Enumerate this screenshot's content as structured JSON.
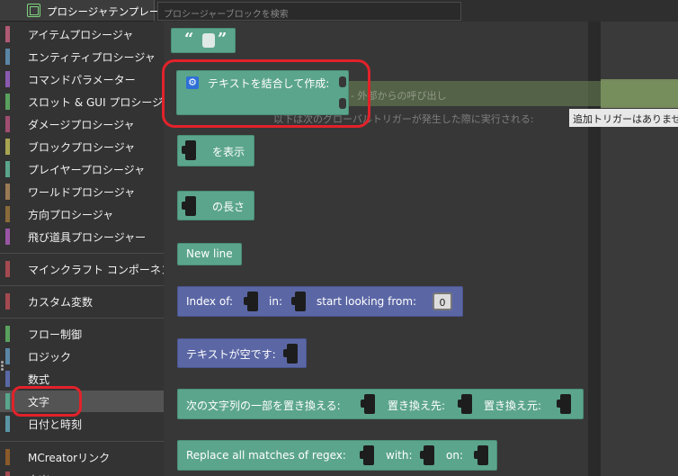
{
  "tab": {
    "label": "プロシージャテンプレート"
  },
  "search": {
    "placeholder": "プロシージャーブロックを検索"
  },
  "sidebar": {
    "group1": [
      {
        "label": "アイテムプロシージャ",
        "color": "#b05a73"
      },
      {
        "label": "エンティティプロシージャ",
        "color": "#5a86a5"
      },
      {
        "label": "コマンドパラメーター",
        "color": "#8a5ab0"
      },
      {
        "label": "スロット & GUI プロシージャ",
        "color": "#5aa05e"
      },
      {
        "label": "ダメージプロシージャ",
        "color": "#a14e70"
      },
      {
        "label": "ブロックプロシージャ",
        "color": "#a8a552"
      },
      {
        "label": "プレイヤープロシージャ",
        "color": "#5aa58c"
      },
      {
        "label": "ワールドプロシージャ",
        "color": "#9a7a55"
      },
      {
        "label": "方向プロシージャ",
        "color": "#8a6a3a"
      },
      {
        "label": "飛び道具プロシージャー",
        "color": "#9a55a5"
      }
    ],
    "group2": [
      {
        "label": "マインクラフト コンポーネント",
        "color": "#a34a50"
      }
    ],
    "group3": [
      {
        "label": "カスタム変数",
        "color": "#a34a50"
      }
    ],
    "group4": [
      {
        "label": "フロー制御",
        "color": "#5aa05e"
      },
      {
        "label": "ロジック",
        "color": "#5a86a5"
      },
      {
        "label": "数式",
        "color": "#5a68a5"
      },
      {
        "label": "文字",
        "color": "#5aa58c"
      },
      {
        "label": "日付と時刻",
        "color": "#5a95a5"
      }
    ],
    "group5": [
      {
        "label": "MCreatorリンク",
        "color": "#8a5a2a"
      },
      {
        "label": "音楽",
        "color": "#a34a50"
      }
    ]
  },
  "workspace": {
    "ghost_line1": "- 外部からの呼び出し",
    "ghost_line2": "以下は次のグローバルトリガーが発生した際に実行される:",
    "ghost_field": "追加トリガーはありません"
  },
  "blocks": {
    "quote_open": "“",
    "quote_close": "”",
    "join_label": "テキストを結合して作成:",
    "print_label": "を表示",
    "length_label": "の長さ",
    "newline_label": "New line",
    "index_of_label": "Index of:",
    "in_label": "in:",
    "start_looking_label": "start looking from:",
    "start_value": "0",
    "is_empty_label": "テキストが空です:",
    "replace_label": "次の文字列の一部を置き換える:",
    "replace_to_label": "置き換え先:",
    "replace_from_label": "置き換え元:",
    "regex_label": "Replace all matches of regex:",
    "with_label": "with:",
    "on_label": "on:"
  },
  "colors": {
    "text_block": "#5ba58c",
    "math_block": "#5b67a5",
    "highlight": "#e2222a"
  }
}
